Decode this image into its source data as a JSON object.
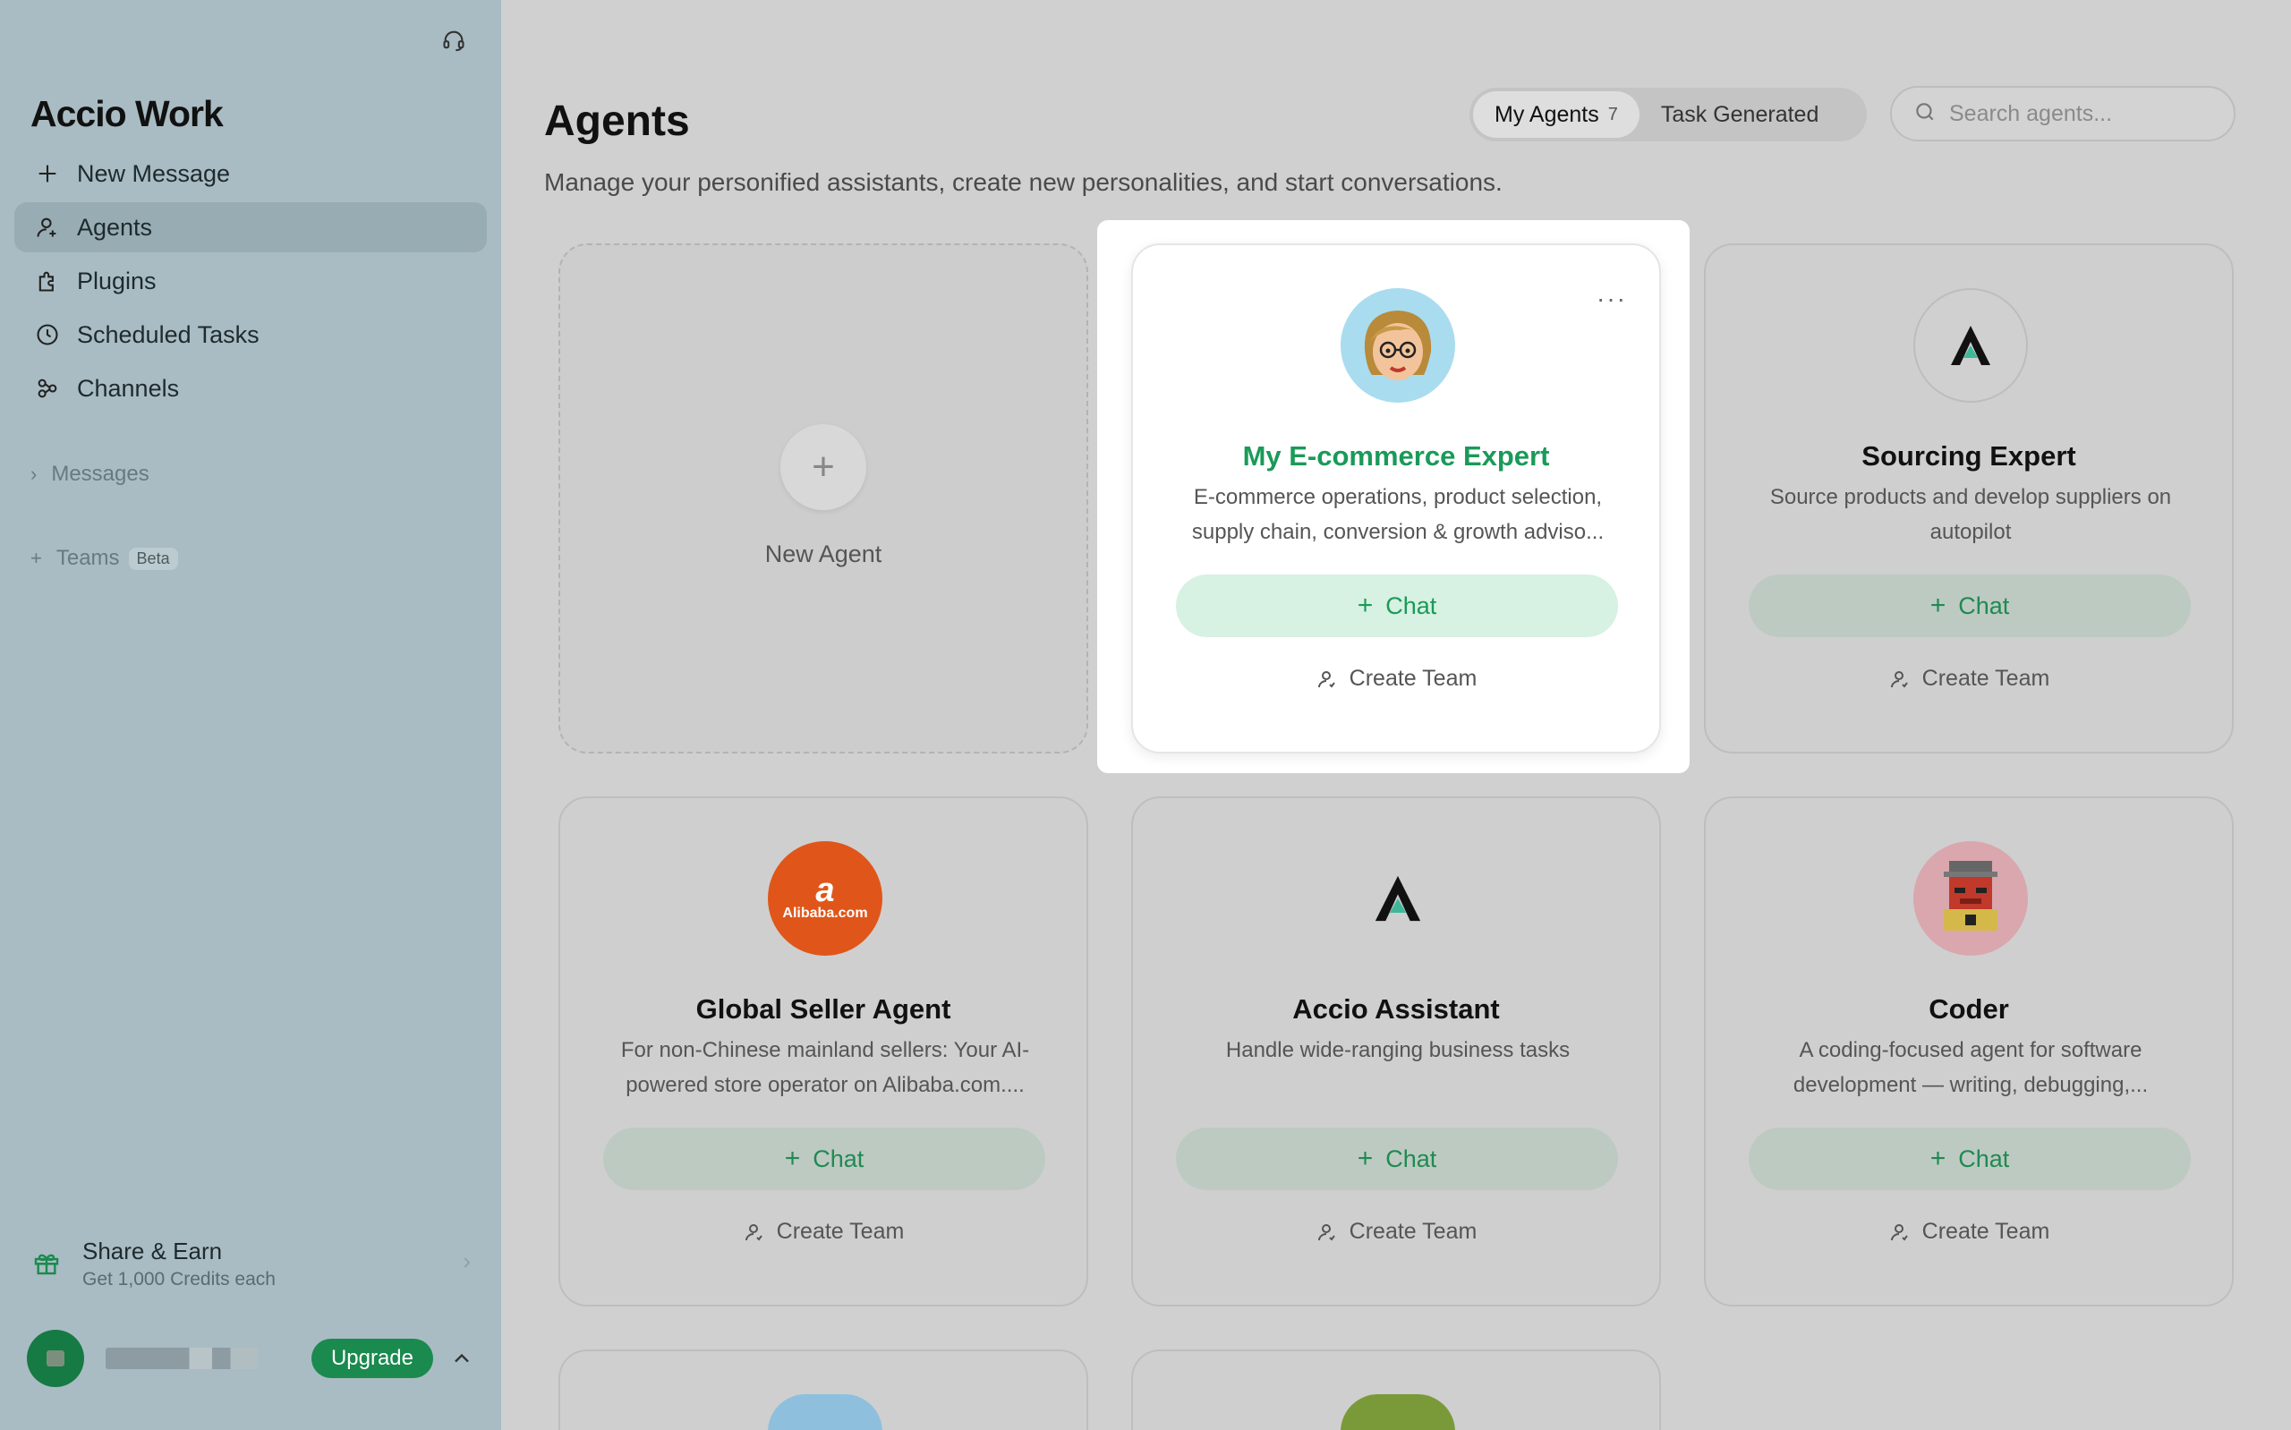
{
  "sidebar": {
    "logo": "Accio Work",
    "nav": [
      {
        "label": "New Message",
        "icon": "plus-icon"
      },
      {
        "label": "Agents",
        "icon": "user-icon",
        "active": true
      },
      {
        "label": "Plugins",
        "icon": "puzzle-icon"
      },
      {
        "label": "Scheduled Tasks",
        "icon": "clock-icon"
      },
      {
        "label": "Channels",
        "icon": "share-nodes-icon"
      }
    ],
    "messages_label": "Messages",
    "teams_label": "Teams",
    "teams_badge": "Beta",
    "share": {
      "title": "Share & Earn",
      "subtitle": "Get 1,000 Credits each"
    },
    "upgrade_label": "Upgrade"
  },
  "header": {
    "title": "Agents",
    "subtitle": "Manage your personified assistants, create new personalities, and start conversations.",
    "tabs": [
      {
        "label": "My Agents",
        "count": "7",
        "active": true
      },
      {
        "label": "Task Generated"
      }
    ],
    "search_placeholder": "Search agents..."
  },
  "new_agent_label": "New Agent",
  "chat_label": "Chat",
  "create_team_label": "Create Team",
  "agents": [
    {
      "name": "My E-commerce Expert",
      "description": "E-commerce operations, product selection,\nsupply chain, conversion & growth adviso...",
      "avatar": "cartoon-woman-avatar"
    },
    {
      "name": "Sourcing Expert",
      "description": "Source products and develop suppliers on\nautopilot",
      "avatar": "accio-logo-avatar"
    },
    {
      "name": "Global Seller Agent",
      "description": "For non-Chinese mainland sellers: Your AI-\npowered store operator on Alibaba.com....",
      "avatar": "alibaba-logo-avatar",
      "avatar_text": "Alibaba.com"
    },
    {
      "name": "Accio Assistant",
      "description": "Handle wide-ranging business tasks",
      "avatar": "accio-logo-avatar"
    },
    {
      "name": "Coder",
      "description": "A coding-focused agent for software\ndevelopment — writing, debugging,...",
      "avatar": "pixel-robot-avatar"
    }
  ],
  "colors": {
    "accent": "#1a9a59",
    "sidebar": "#a9bcc3",
    "upgrade": "#1a8a4e"
  }
}
